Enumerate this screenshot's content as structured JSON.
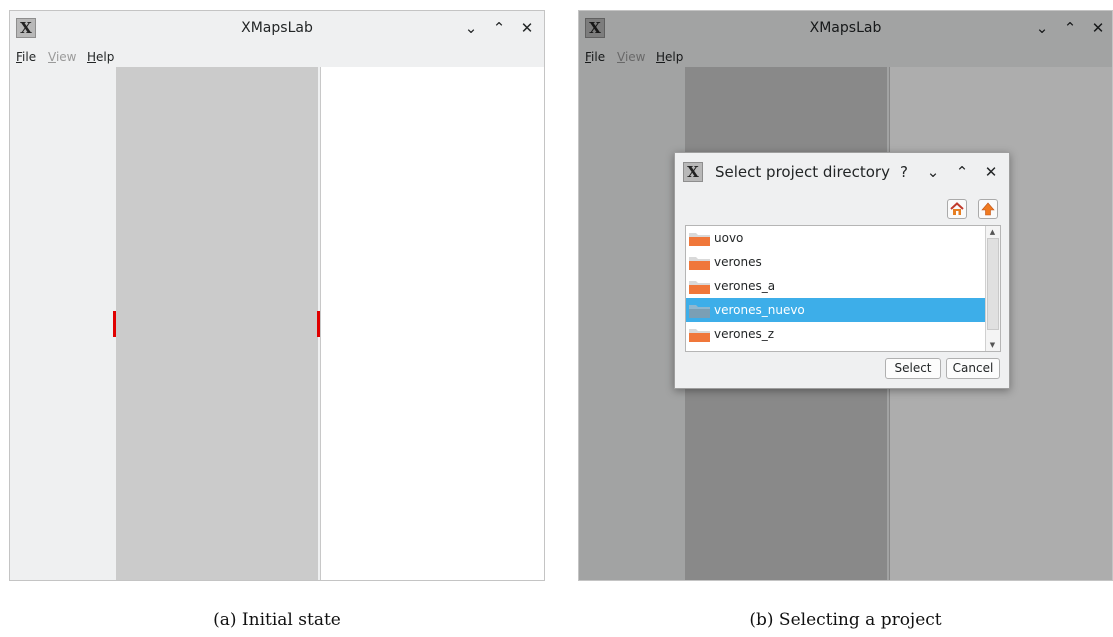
{
  "panel_a": {
    "window": {
      "title": "XMapsLab",
      "icon": "xmapslab-icon"
    },
    "menu": [
      {
        "label_mnemonic": "F",
        "label_rest": "ile",
        "enabled": true
      },
      {
        "label_mnemonic": "V",
        "label_rest": "iew",
        "enabled": false
      },
      {
        "label_mnemonic": "H",
        "label_rest": "elp",
        "enabled": true
      }
    ],
    "caption": "(a)  Initial state"
  },
  "panel_b": {
    "window": {
      "title": "XMapsLab",
      "icon": "xmapslab-icon"
    },
    "menu": [
      {
        "label_mnemonic": "F",
        "label_rest": "ile",
        "enabled": true
      },
      {
        "label_mnemonic": "V",
        "label_rest": "iew",
        "enabled": false
      },
      {
        "label_mnemonic": "H",
        "label_rest": "elp",
        "enabled": true
      }
    ],
    "dialog": {
      "title": "Select project directory",
      "help_glyph": "?",
      "folders": [
        "uovo",
        "verones",
        "verones_a",
        "verones_nuevo",
        "verones_z"
      ],
      "selected_index": 3,
      "select_label": "Select",
      "cancel_label": "Cancel"
    },
    "caption": "(b)  Selecting a project"
  },
  "colors": {
    "window_bg": "#eff0f1",
    "mid_pane": "#cbcbcb",
    "selection": "#3daee9",
    "marker": "#e00000",
    "folder": "#f0773a"
  }
}
